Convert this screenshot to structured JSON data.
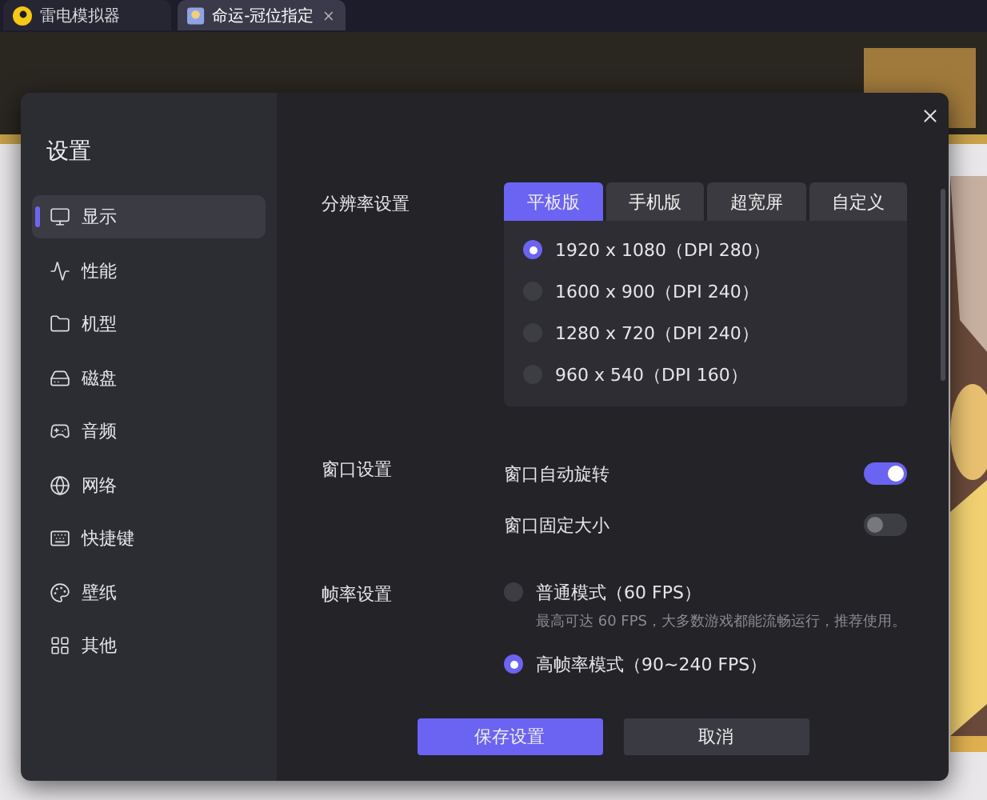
{
  "tabs": [
    {
      "label": "雷电模拟器",
      "selected": false,
      "closable": false
    },
    {
      "label": "命运-冠位指定",
      "selected": true,
      "closable": true
    }
  ],
  "dialog": {
    "title": "设置",
    "nav": [
      {
        "label": "显示",
        "selected": true
      },
      {
        "label": "性能",
        "selected": false
      },
      {
        "label": "机型",
        "selected": false
      },
      {
        "label": "磁盘",
        "selected": false
      },
      {
        "label": "音频",
        "selected": false
      },
      {
        "label": "网络",
        "selected": false
      },
      {
        "label": "快捷键",
        "selected": false
      },
      {
        "label": "壁纸",
        "selected": false
      },
      {
        "label": "其他",
        "selected": false
      }
    ],
    "resolution": {
      "label": "分辨率设置",
      "modes": [
        {
          "label": "平板版",
          "selected": true
        },
        {
          "label": "手机版",
          "selected": false
        },
        {
          "label": "超宽屏",
          "selected": false
        },
        {
          "label": "自定义",
          "selected": false
        }
      ],
      "options": [
        {
          "label": "1920 x 1080（DPI 280）",
          "selected": true
        },
        {
          "label": "1600 x 900（DPI 240）",
          "selected": false
        },
        {
          "label": "1280 x 720（DPI 240）",
          "selected": false
        },
        {
          "label": "960 x 540（DPI 160）",
          "selected": false
        }
      ]
    },
    "window": {
      "label": "窗口设置",
      "toggles": [
        {
          "label": "窗口自动旋转",
          "on": true
        },
        {
          "label": "窗口固定大小",
          "on": false
        }
      ]
    },
    "framerate": {
      "label": "帧率设置",
      "options": [
        {
          "label": "普通模式（60 FPS）",
          "description": "最高可达 60 FPS，大多数游戏都能流畅运行，推荐使用。",
          "selected": false
        },
        {
          "label": "高帧率模式（90~240 FPS）",
          "selected": true
        }
      ]
    },
    "buttons": [
      {
        "label": "保存设置",
        "kind": "primary"
      },
      {
        "label": "取消",
        "kind": "secondary"
      }
    ]
  }
}
